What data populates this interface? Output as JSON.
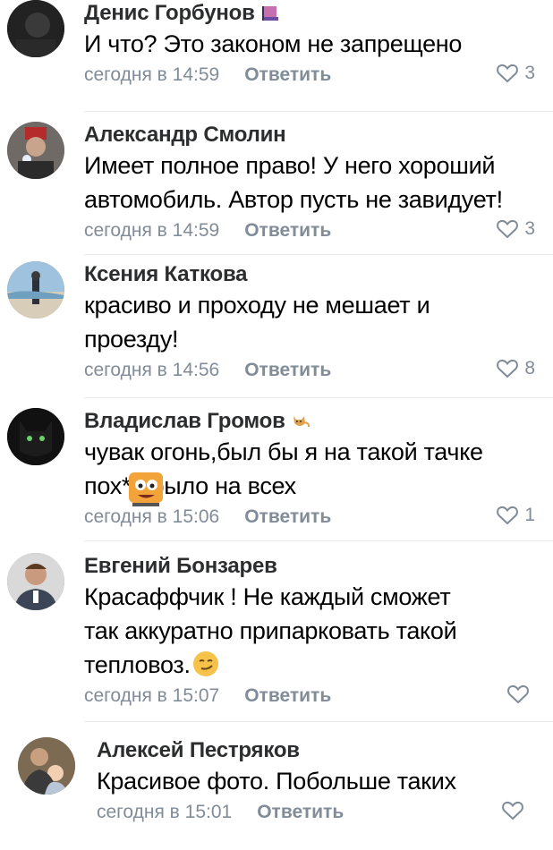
{
  "comments": [
    {
      "name": "Денис Горбунов",
      "lines": [
        "И что? Это законом не запрещено"
      ],
      "date": "сегодня в 14:59",
      "reply": "Ответить",
      "likes": "3",
      "name_icon": "flag-icon"
    },
    {
      "name": "Александр Смолин",
      "lines": [
        "Имеет полное право! У него хороший",
        "автомобиль. Автор пусть не завидует!"
      ],
      "date": "сегодня в 14:59",
      "reply": "Ответить",
      "likes": "3"
    },
    {
      "name": "Ксения Каткова",
      "lines": [
        "красиво и проходу не мешает и",
        "проезду!"
      ],
      "date": "сегодня в 14:56",
      "reply": "Ответить",
      "likes": "8"
    },
    {
      "name": "Владислав Громов",
      "lines": [
        "чувак огонь,был бы я на такой тачке",
        "пох*й было на всех"
      ],
      "date": "сегодня в 15:06",
      "reply": "Ответить",
      "likes": "1",
      "name_icon": "cat-icon",
      "sticker": "cartoon-sticker-icon"
    },
    {
      "name": "Евгений Бонзарев",
      "lines": [
        "Красаффчик ! Не каждый сможет",
        "так аккуратно припарковать такой",
        "тепловоз."
      ],
      "date": "сегодня в 15:07",
      "reply": "Ответить",
      "likes": "",
      "emoji": "smirk-emoji-icon"
    },
    {
      "name": "Алексей Пестряков",
      "lines": [
        "Красивое фото. Побольше таких"
      ],
      "date": "сегодня в 15:01",
      "reply": "Ответить",
      "likes": ""
    }
  ],
  "colors": {
    "text": "#000000",
    "name": "#2c2d2e",
    "meta": "#818c99",
    "separator": "#e7e8ec",
    "background": "#ffffff"
  }
}
